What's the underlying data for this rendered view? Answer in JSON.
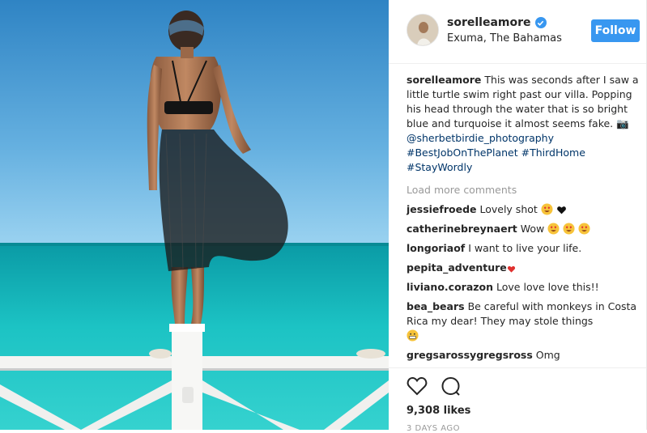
{
  "post": {
    "username": "sorelleamore",
    "location": "Exuma, The Bahamas",
    "follow_label": "Follow"
  },
  "caption": {
    "username": "sorelleamore",
    "text": "This was seconds after I saw a little turtle swim right past our villa. Popping his head through the water that is so bright blue and turquoise it almost seems fake. 📷",
    "mention": "@sherbetbirdie_photography",
    "tag1": "#BestJobOnThePlanet",
    "tag2": "#ThirdHome",
    "tag3": "#StayWordly"
  },
  "load_more": "Load more comments",
  "comments": [
    {
      "user": "jessiefroede",
      "text": "Lovely shot"
    },
    {
      "user": "catherinebreynaert",
      "text": "Wow"
    },
    {
      "user": "longoriaof",
      "text": "I want to live your life."
    },
    {
      "user": "pepita_adventure",
      "text": ""
    },
    {
      "user": "liviano.corazon",
      "text": "Love love love this!!"
    },
    {
      "user": "bea_bears",
      "text": "Be careful with monkeys in Costa Rica my dear! They may stole things"
    },
    {
      "user": "gregsarossygregsross",
      "text": "Omg"
    }
  ],
  "likes": "9,308 likes",
  "timestamp": "3 DAYS AGO",
  "colors": {
    "accent": "#3897f0",
    "link": "#003569",
    "muted": "#999999"
  },
  "icons": [
    "verified-icon",
    "heart-icon",
    "comment-icon",
    "heart-eyes-emoji",
    "black-heart-emoji"
  ]
}
